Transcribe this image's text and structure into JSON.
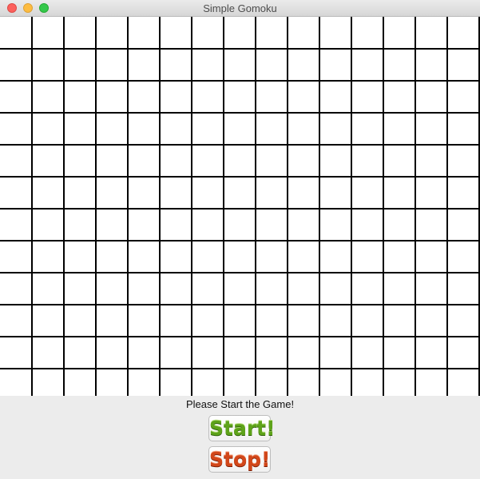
{
  "window": {
    "title": "Simple Gomoku",
    "controls": [
      "close",
      "minimize",
      "zoom"
    ]
  },
  "board": {
    "background": "#ffffff",
    "line_color": "#000000"
  },
  "status": {
    "message": "Please Start the Game!"
  },
  "buttons": {
    "start_label": "Start!",
    "stop_label": "Stop!",
    "start_color": "#5ea31a",
    "stop_color": "#d2471a"
  }
}
